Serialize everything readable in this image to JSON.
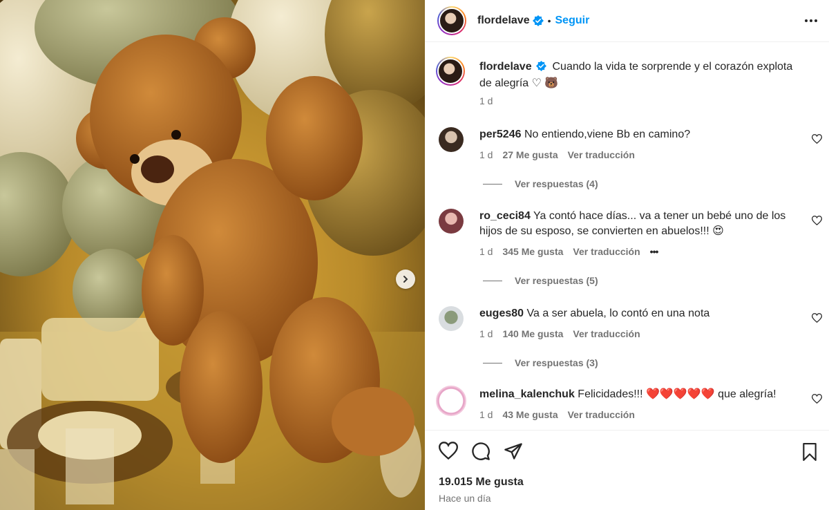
{
  "post": {
    "username": "flordelave",
    "follow_label": "Seguir",
    "separator": "•",
    "caption_text": "Cuando la vida te sorprende y el corazón explota de alegría ♡ 🐻",
    "caption_time": "1 d",
    "likes": "19.015 Me gusta",
    "time_ago": "Hace un día"
  },
  "comments": [
    {
      "username": "per5246",
      "text": "No entiendo,viene Bb en camino?",
      "time": "1 d",
      "likes": "27 Me gusta",
      "translate": "Ver traducción",
      "replies": "Ver respuestas (4)"
    },
    {
      "username": "ro_ceci84",
      "text": "Ya contó hace días... va a tener un bebé uno de los hijos de su esposo, se convierten en abuelos!!! 😍",
      "time": "1 d",
      "likes": "345 Me gusta",
      "translate": "Ver traducción",
      "more": "•••",
      "replies": "Ver respuestas (5)"
    },
    {
      "username": "euges80",
      "text": "Va a ser abuela, lo contó en una nota",
      "time": "1 d",
      "likes": "140 Me gusta",
      "translate": "Ver traducción",
      "replies": "Ver respuestas (3)"
    },
    {
      "username": "melina_kalenchuk",
      "text": "Felicidades!!! ❤️❤️❤️❤️❤️ que alegría!",
      "time": "1 d",
      "likes": "43 Me gusta",
      "translate": "Ver traducción"
    }
  ],
  "icons": {
    "verified": "verified-badge-icon",
    "more": "more-options-icon",
    "next": "chevron-right-icon",
    "like": "heart-icon",
    "comment": "comment-icon",
    "share": "share-icon",
    "save": "bookmark-icon"
  },
  "colors": {
    "accent": "#0095f6",
    "text": "#262626",
    "muted": "#737373"
  }
}
